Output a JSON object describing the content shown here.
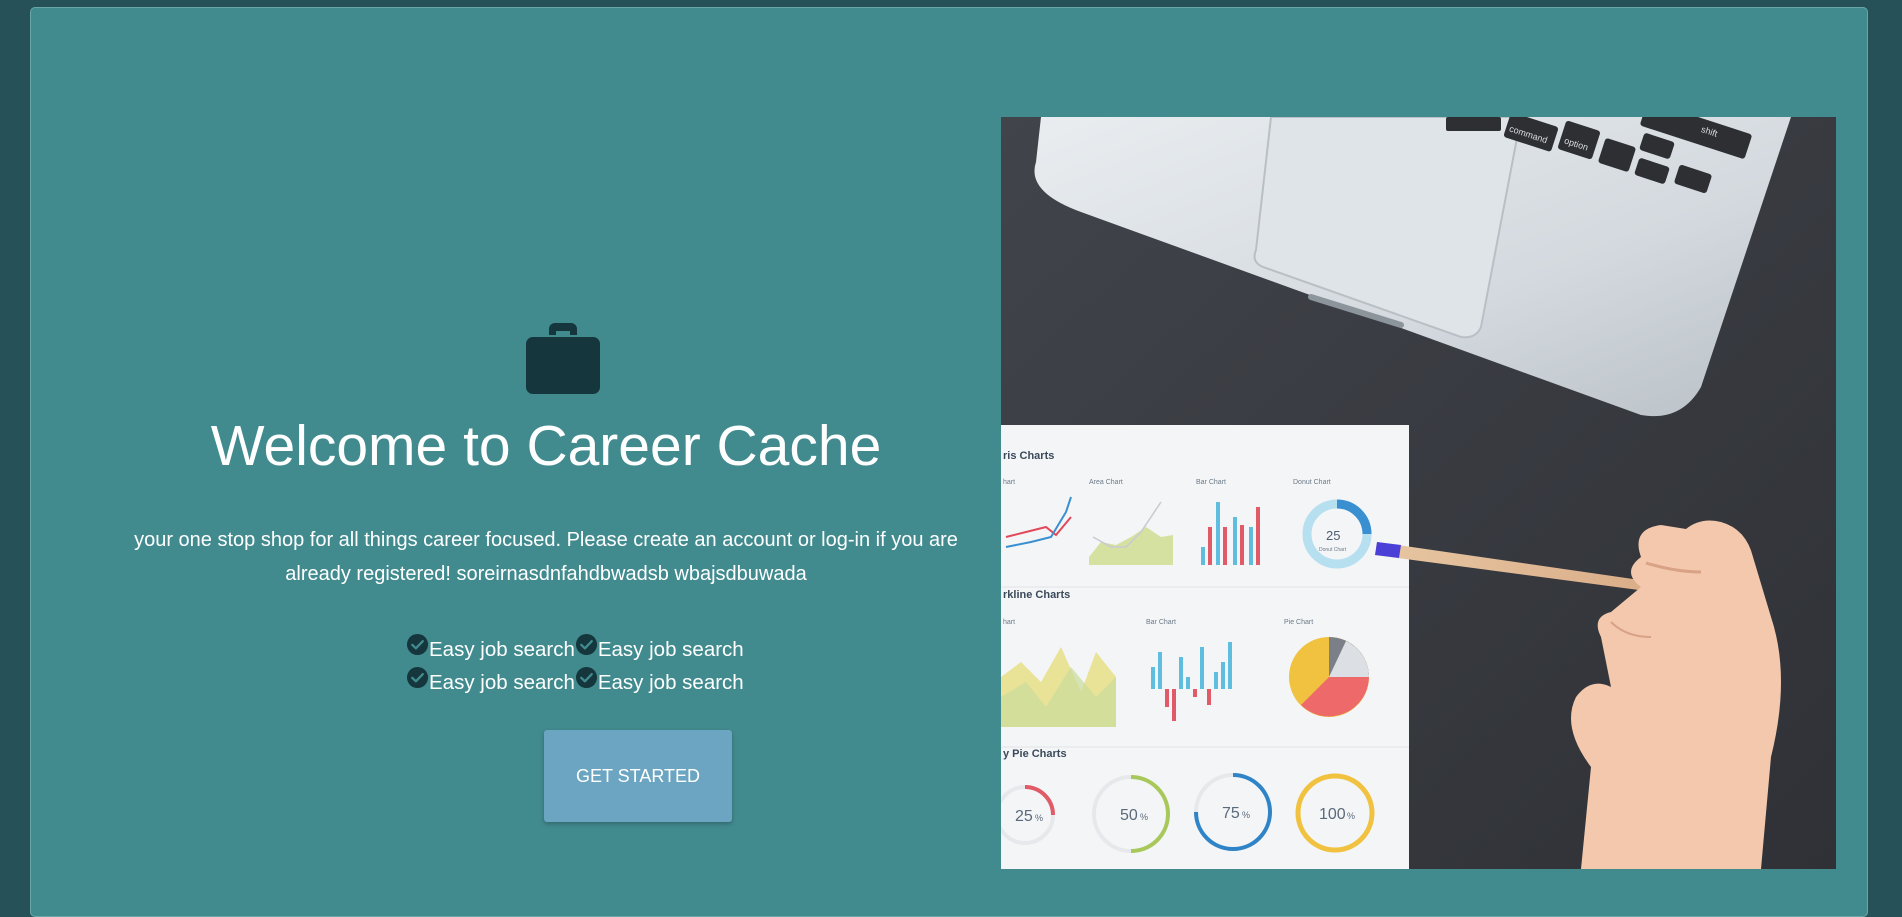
{
  "hero": {
    "icon": "briefcase-icon",
    "title": "Welcome to Career Cache",
    "subtitle": "your one stop shop for all things career focused. Please create an account or log-in if you are already registered! soreirnasdnfahdbwadsb wbajsdbuwada",
    "features": [
      {
        "icon": "check-circle-icon",
        "label": "Easy job search"
      },
      {
        "icon": "check-circle-icon",
        "label": "Easy job search"
      },
      {
        "icon": "check-circle-icon",
        "label": "Easy job search"
      },
      {
        "icon": "check-circle-icon",
        "label": "Easy job search"
      }
    ],
    "cta_label": "GET STARTED"
  },
  "image": {
    "subject": "laptop-and-charts-photo",
    "chart_sheet": {
      "headings": [
        "ris Charts",
        "rkline Charts",
        "y Pie Charts"
      ],
      "mini_labels": [
        "hart",
        "Area Chart",
        "Bar Chart",
        "Donut Chart",
        "hart",
        "Bar Chart",
        "Pie Chart"
      ],
      "keyboard_keys": [
        "command",
        "option",
        "shift"
      ],
      "donut_label": "25",
      "donut_caption": "Donut Chart",
      "ring_values": [
        "25",
        "50",
        "75",
        "100"
      ],
      "ring_unit": "%"
    }
  },
  "colors": {
    "page_bg": "#275159",
    "card_bg": "#418b8f",
    "icon": "#14363c",
    "button": "#6ba5c1",
    "text": "#ffffff"
  }
}
